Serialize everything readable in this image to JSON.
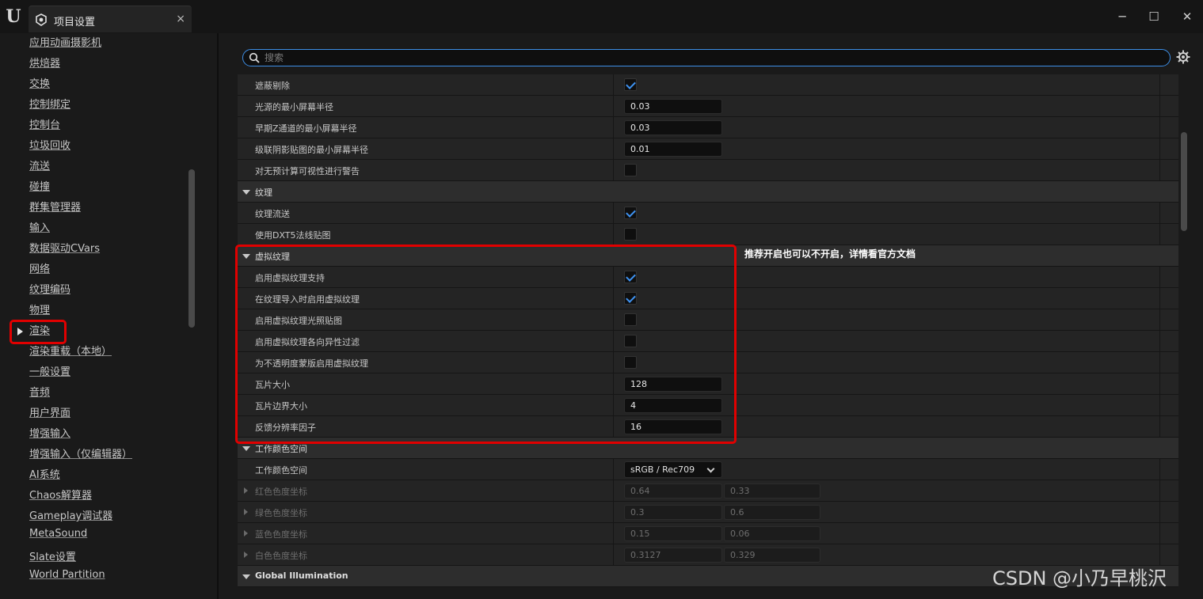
{
  "window": {
    "tab_title": "项目设置",
    "tab_close": "×",
    "minimize": "─",
    "maximize": "☐",
    "close": "✕"
  },
  "sidebar": {
    "items": [
      {
        "label": "应用动画摄影机"
      },
      {
        "label": "烘焙器"
      },
      {
        "label": "交换"
      },
      {
        "label": "控制绑定"
      },
      {
        "label": "控制台"
      },
      {
        "label": "垃圾回收"
      },
      {
        "label": "流送"
      },
      {
        "label": "碰撞"
      },
      {
        "label": "群集管理器"
      },
      {
        "label": "输入"
      },
      {
        "label": "数据驱动CVars"
      },
      {
        "label": "网络"
      },
      {
        "label": "纹理编码"
      },
      {
        "label": "物理"
      },
      {
        "label": "渲染",
        "selected": true
      },
      {
        "label": "渲染重载（本地）"
      },
      {
        "label": "一般设置"
      },
      {
        "label": "音频"
      },
      {
        "label": "用户界面"
      },
      {
        "label": "增强输入"
      },
      {
        "label": "增强输入（仅编辑器）"
      },
      {
        "label": "AI系统"
      },
      {
        "label": "Chaos解算器"
      },
      {
        "label": "Gameplay调试器"
      },
      {
        "label": "MetaSound"
      },
      {
        "label": "Slate设置"
      },
      {
        "label": "World Partition"
      }
    ]
  },
  "search": {
    "placeholder": "搜索",
    "value": ""
  },
  "settings": {
    "rows": [
      {
        "type": "check",
        "label": "遮蔽剔除",
        "checked": true
      },
      {
        "type": "number",
        "label": "光源的最小屏幕半径",
        "value": "0.03"
      },
      {
        "type": "number",
        "label": "早期Z通道的最小屏幕半径",
        "value": "0.03"
      },
      {
        "type": "number",
        "label": "级联阴影贴图的最小屏幕半径",
        "value": "0.01"
      },
      {
        "type": "check",
        "label": "对无预计算可视性进行警告",
        "checked": false
      },
      {
        "type": "section",
        "label": "纹理"
      },
      {
        "type": "check",
        "label": "纹理流送",
        "checked": true
      },
      {
        "type": "check",
        "label": "使用DXT5法线贴图",
        "checked": false
      },
      {
        "type": "section",
        "label": "虚拟纹理"
      },
      {
        "type": "check",
        "label": "启用虚拟纹理支持",
        "checked": true
      },
      {
        "type": "check",
        "label": "在纹理导入时启用虚拟纹理",
        "checked": true
      },
      {
        "type": "check",
        "label": "启用虚拟纹理光照贴图",
        "checked": false
      },
      {
        "type": "check",
        "label": "启用虚拟纹理各向异性过滤",
        "checked": false
      },
      {
        "type": "check",
        "label": "为不透明度蒙版启用虚拟纹理",
        "checked": false
      },
      {
        "type": "number",
        "label": "瓦片大小",
        "value": "128"
      },
      {
        "type": "number",
        "label": "瓦片边界大小",
        "value": "4"
      },
      {
        "type": "number",
        "label": "反馈分辨率因子",
        "value": "16"
      },
      {
        "type": "section",
        "label": "工作颜色空间"
      },
      {
        "type": "dropdown",
        "label": "工作颜色空间",
        "value": "sRGB / Rec709"
      },
      {
        "type": "pair",
        "label": "红色色度坐标",
        "value1": "0.64",
        "value2": "0.33"
      },
      {
        "type": "pair",
        "label": "绿色色度坐标",
        "value1": "0.3",
        "value2": "0.6"
      },
      {
        "type": "pair",
        "label": "蓝色色度坐标",
        "value1": "0.15",
        "value2": "0.06"
      },
      {
        "type": "pair",
        "label": "白色色度坐标",
        "value1": "0.3127",
        "value2": "0.329"
      },
      {
        "type": "section-bold",
        "label": "Global Illumination"
      }
    ]
  },
  "annotation": "推荐开启也可以不开启，详情看官方文档",
  "watermark": "CSDN @小乃早桃沢",
  "colors": {
    "accent": "#3f93f2",
    "highlight": "#e10000",
    "background": "#1a1a1a",
    "row": "#242424",
    "section": "#2d2d2d"
  }
}
